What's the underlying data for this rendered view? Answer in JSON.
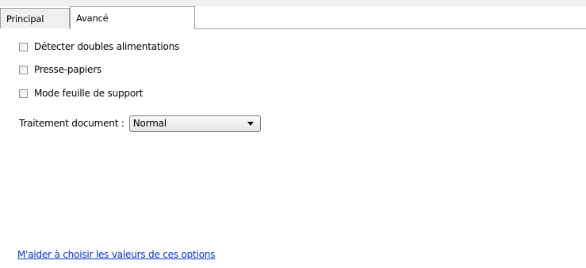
{
  "tabs": [
    {
      "label": "Principal",
      "active": false
    },
    {
      "label": "Avancé",
      "active": true
    }
  ],
  "checkboxes": [
    {
      "label": "Détecter doubles alimentations",
      "checked": false
    },
    {
      "label": "Presse-papiers",
      "checked": false
    },
    {
      "label": "Mode feuille de support",
      "checked": false
    }
  ],
  "document_processing": {
    "label": "Traitement document :",
    "selected": "Normal"
  },
  "help_link": {
    "label": "M'aider à choisir les valeurs de ces options"
  },
  "colors": {
    "link": "#0033cc",
    "tab_border": "#a0a0a0",
    "inactive_tab": "#efefef"
  }
}
